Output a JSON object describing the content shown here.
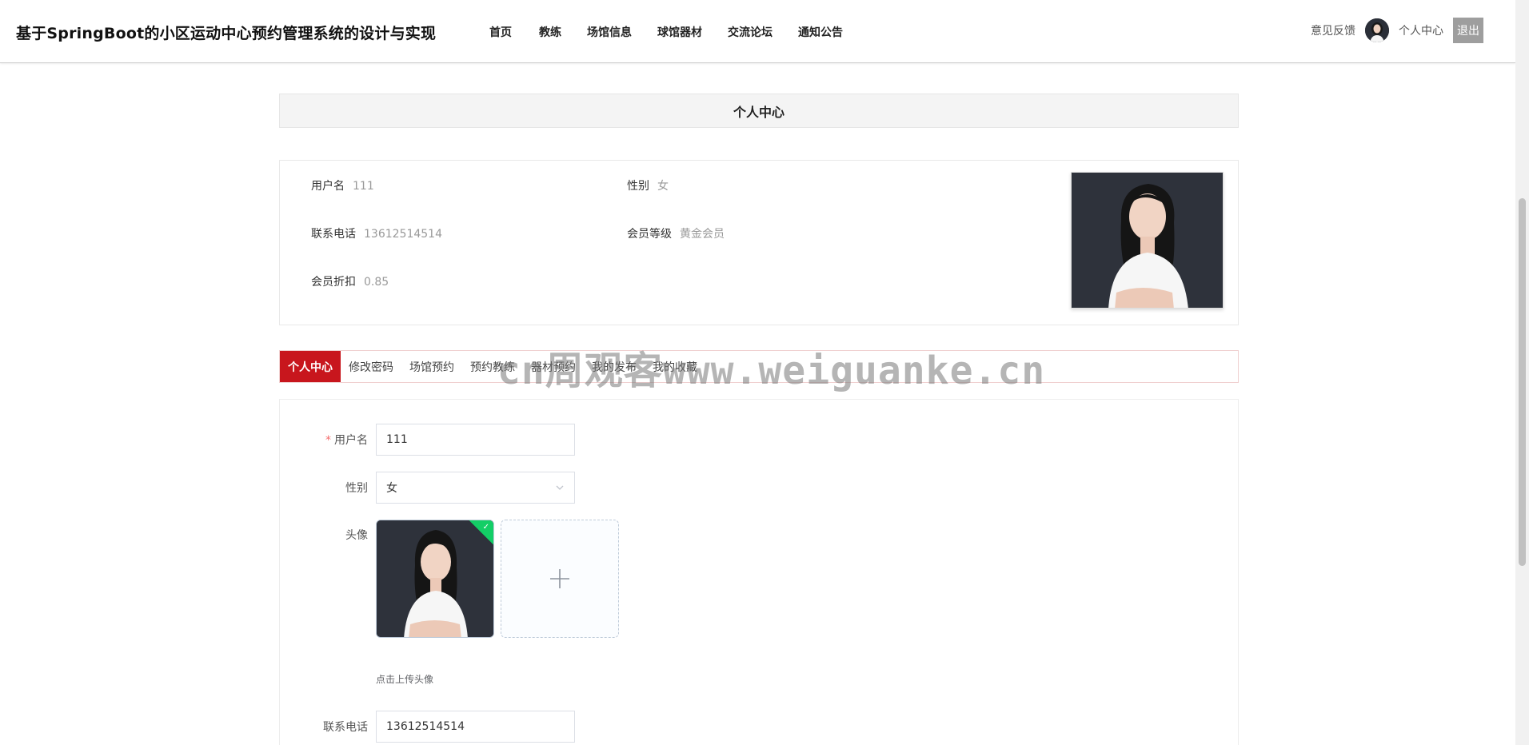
{
  "header": {
    "title": "基于SpringBoot的小区运动中心预约管理系统的设计与实现",
    "nav": [
      "首页",
      "教练",
      "场馆信息",
      "球馆器材",
      "交流论坛",
      "通知公告"
    ],
    "feedback": "意见反馈",
    "center": "个人中心",
    "logout": "退出"
  },
  "page": {
    "heading": "个人中心"
  },
  "profile": {
    "username_label": "用户名",
    "username": "111",
    "gender_label": "性别",
    "gender": "女",
    "phone_label": "联系电话",
    "phone": "13612514514",
    "level_label": "会员等级",
    "level": "黄金会员",
    "discount_label": "会员折扣",
    "discount": "0.85"
  },
  "tabs": [
    "个人中心",
    "修改密码",
    "场馆预约",
    "预约教练",
    "器材预约",
    "我的发布",
    "我的收藏"
  ],
  "form": {
    "username_label": "用户名",
    "username_value": "111",
    "gender_label": "性别",
    "gender_value": "女",
    "avatar_label": "头像",
    "upload_hint": "点击上传头像",
    "phone_label": "联系电话",
    "phone_value": "13612514514"
  },
  "watermark": "cn周观客www.weiguanke.cn",
  "colors": {
    "accent": "#c8161d",
    "success": "#13ce66"
  }
}
